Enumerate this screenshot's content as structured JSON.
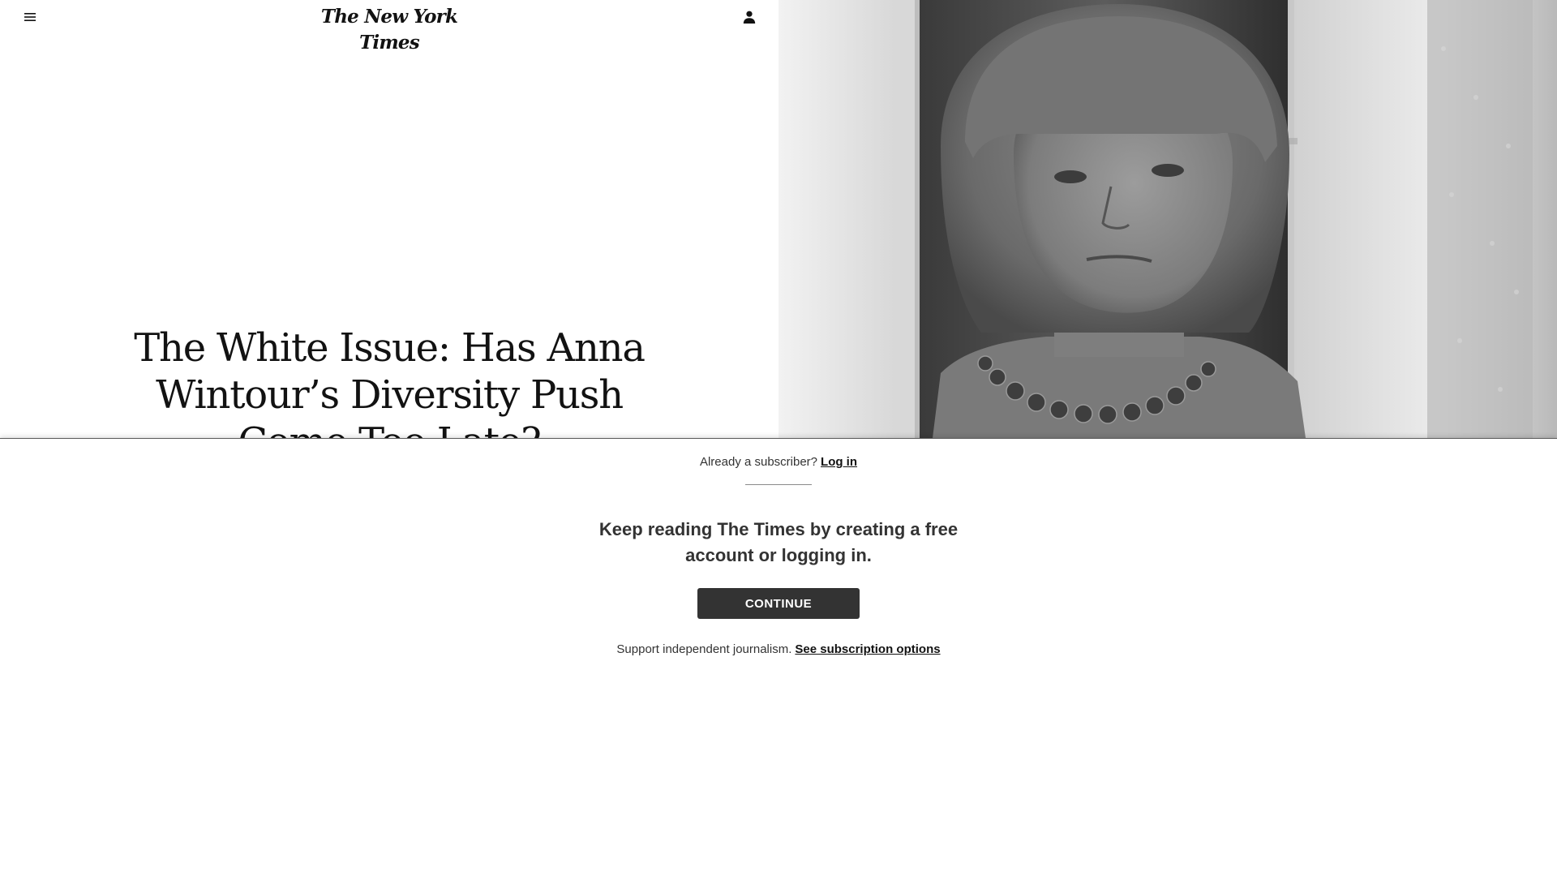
{
  "masthead": {
    "logo_text": "The New York Times",
    "menu_icon": "hamburger-menu-icon",
    "account_icon": "user-account-icon"
  },
  "article": {
    "headline": "The White Issue: Has Anna Wintour’s Diversity Push Come Too Late?"
  },
  "gateway": {
    "already_subscriber_text": "Already a subscriber?",
    "login_link": "Log in",
    "prompt": "Keep reading The Times by creating a free account or logging in.",
    "continue_button": "CONTINUE",
    "support_text": "Support independent journalism.",
    "subscription_link": "See subscription options"
  },
  "colors": {
    "button_bg": "#333333",
    "text": "#121212",
    "border": "#5a5a5a"
  }
}
